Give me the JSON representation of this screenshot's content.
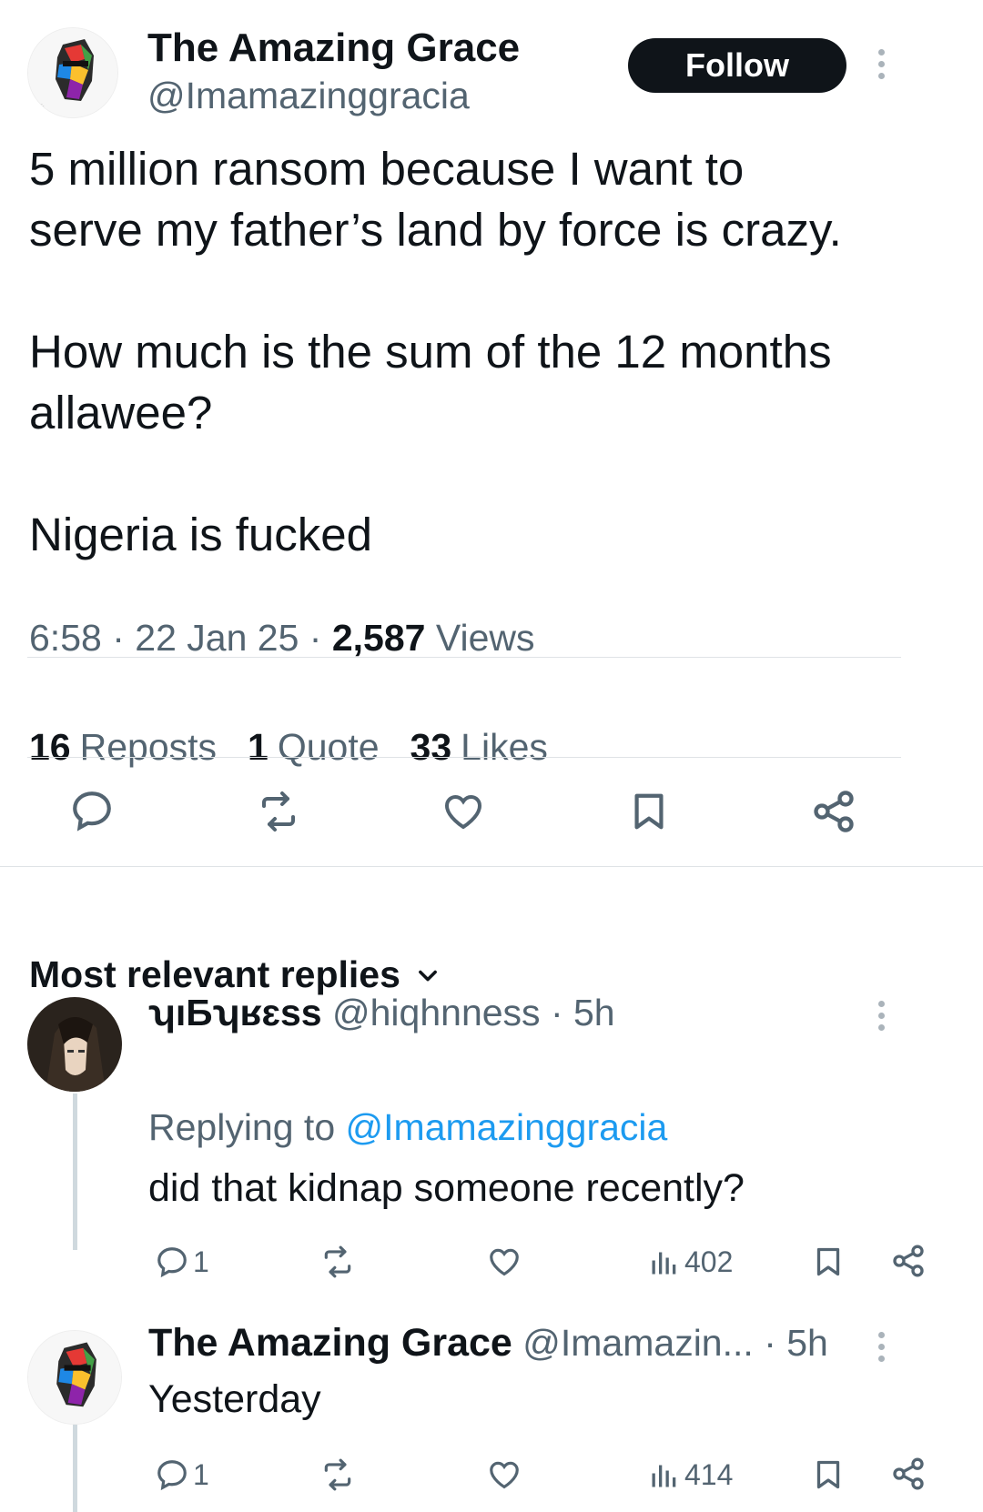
{
  "tweet": {
    "author_name": "The Amazing Grace",
    "author_handle": "@Imamazinggracia",
    "follow_label": "Follow",
    "text": "5 million ransom because I want to\nserve my father’s land by force is crazy.\n\nHow much is the sum of the 12 months\nallawee?\n\nNigeria is fucked",
    "time": "6:58",
    "sep": "·",
    "date": "22 Jan 25",
    "views_count": "2,587",
    "views_label": "Views",
    "stats": {
      "reposts_count": "16",
      "reposts_label": "Reposts",
      "quotes_count": "1",
      "quotes_label": "Quote",
      "likes_count": "33",
      "likes_label": "Likes"
    },
    "actions": [
      "reply-icon",
      "repost-icon",
      "like-icon",
      "bookmark-icon",
      "share-icon"
    ]
  },
  "replies_section": {
    "heading": "Most relevant replies"
  },
  "replies": [
    {
      "name": "ʮıƂʮʁɛss",
      "handle": "@hiqhnness",
      "time": "· 5h",
      "replying_prefix": "Replying to",
      "replying_handle": "@Imamazinggracia",
      "text": "did that kidnap someone recently?",
      "reply_count": "1",
      "views": "402"
    },
    {
      "name": "The Amazing Grace",
      "handle": "@Imamazin...",
      "time": "· 5h",
      "text": "Yesterday",
      "reply_count": "1",
      "views": "414"
    }
  ],
  "colors": {
    "text_primary": "#0f1419",
    "text_secondary": "#536471",
    "link": "#1d9bf0",
    "divider": "#dfe3e6",
    "follow_bg": "#0f1419"
  }
}
